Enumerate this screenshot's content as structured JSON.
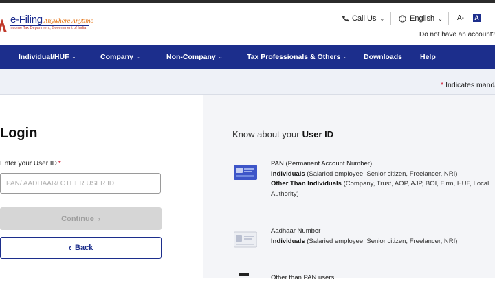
{
  "header": {
    "logo": {
      "title": "e-Filing",
      "tagline": "Anywhere Anytime",
      "subtitle": "Income Tax Department, Government of India"
    },
    "call_us": "Call Us",
    "language": "English",
    "font_smaller": "A-",
    "font_default": "A",
    "no_account": "Do not have an account?"
  },
  "nav": {
    "items": [
      {
        "label": "Individual/HUF",
        "dropdown": true
      },
      {
        "label": "Company",
        "dropdown": true
      },
      {
        "label": "Non-Company",
        "dropdown": true
      },
      {
        "label": "Tax Professionals & Others",
        "dropdown": true
      },
      {
        "label": "Downloads",
        "dropdown": false
      },
      {
        "label": "Help",
        "dropdown": false
      }
    ]
  },
  "mandatory_note": "Indicates manda",
  "login": {
    "title": "Login",
    "userid_label": "Enter your User ID",
    "required_mark": "*",
    "userid_placeholder": "PAN/ AADHAAR/ OTHER USER ID",
    "userid_value": "",
    "continue_label": "Continue",
    "back_label": "Back"
  },
  "know": {
    "title_prefix": "Know about your",
    "title_bold": "User ID",
    "items": [
      {
        "heading": "PAN (Permanent Account Number)",
        "lines": [
          {
            "bold": "Individuals",
            "text": "(Salaried employee, Senior citizen, Freelancer, NRI)"
          },
          {
            "bold": "Other Than Individuals",
            "text": "(Company, Trust, AOP, AJP, BOI, Firm, HUF, Local Authority)"
          }
        ],
        "icon": "pan-card-icon"
      },
      {
        "heading": "Aadhaar Number",
        "lines": [
          {
            "bold": "Individuals",
            "text": "(Salaried employee, Senior citizen, Freelancer, NRI)"
          }
        ],
        "icon": "aadhaar-card-icon"
      },
      {
        "heading": "Other than PAN users",
        "icon": "other-user-icon"
      }
    ]
  },
  "colors": {
    "nav_bg": "#1c2e8c",
    "brand_blue": "#1c2c8f",
    "required_red": "#d0021b",
    "disabled_btn": "#d6d6d6"
  }
}
